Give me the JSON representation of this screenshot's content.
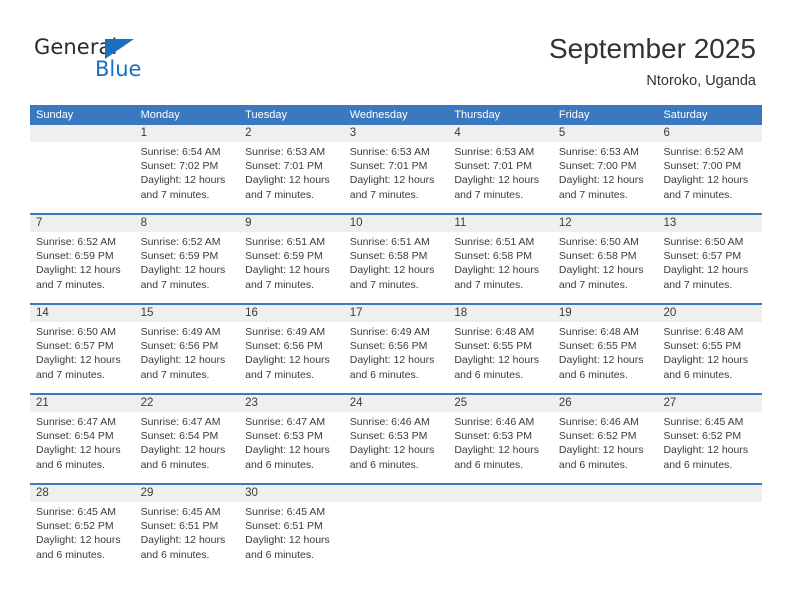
{
  "brand": {
    "name_top": "General",
    "name_bottom": "Blue",
    "triangle_color": "#1b6ec2",
    "text_color": "#2b2b2b"
  },
  "header": {
    "title": "September 2025",
    "subtitle": "Ntoroko, Uganda"
  },
  "theme": {
    "header_blue": "#3a79bf",
    "daynumber_band": "#efefef",
    "text": "#3b3b3b"
  },
  "weekday_headers": [
    "Sunday",
    "Monday",
    "Tuesday",
    "Wednesday",
    "Thursday",
    "Friday",
    "Saturday"
  ],
  "weeks": [
    {
      "days": [
        {
          "number": "",
          "lines": [
            "",
            "",
            "",
            ""
          ]
        },
        {
          "number": "1",
          "lines": [
            "Sunrise: 6:54 AM",
            "Sunset: 7:02 PM",
            "Daylight: 12 hours",
            "and 7 minutes."
          ]
        },
        {
          "number": "2",
          "lines": [
            "Sunrise: 6:53 AM",
            "Sunset: 7:01 PM",
            "Daylight: 12 hours",
            "and 7 minutes."
          ]
        },
        {
          "number": "3",
          "lines": [
            "Sunrise: 6:53 AM",
            "Sunset: 7:01 PM",
            "Daylight: 12 hours",
            "and 7 minutes."
          ]
        },
        {
          "number": "4",
          "lines": [
            "Sunrise: 6:53 AM",
            "Sunset: 7:01 PM",
            "Daylight: 12 hours",
            "and 7 minutes."
          ]
        },
        {
          "number": "5",
          "lines": [
            "Sunrise: 6:53 AM",
            "Sunset: 7:00 PM",
            "Daylight: 12 hours",
            "and 7 minutes."
          ]
        },
        {
          "number": "6",
          "lines": [
            "Sunrise: 6:52 AM",
            "Sunset: 7:00 PM",
            "Daylight: 12 hours",
            "and 7 minutes."
          ]
        }
      ]
    },
    {
      "days": [
        {
          "number": "7",
          "lines": [
            "Sunrise: 6:52 AM",
            "Sunset: 6:59 PM",
            "Daylight: 12 hours",
            "and 7 minutes."
          ]
        },
        {
          "number": "8",
          "lines": [
            "Sunrise: 6:52 AM",
            "Sunset: 6:59 PM",
            "Daylight: 12 hours",
            "and 7 minutes."
          ]
        },
        {
          "number": "9",
          "lines": [
            "Sunrise: 6:51 AM",
            "Sunset: 6:59 PM",
            "Daylight: 12 hours",
            "and 7 minutes."
          ]
        },
        {
          "number": "10",
          "lines": [
            "Sunrise: 6:51 AM",
            "Sunset: 6:58 PM",
            "Daylight: 12 hours",
            "and 7 minutes."
          ]
        },
        {
          "number": "11",
          "lines": [
            "Sunrise: 6:51 AM",
            "Sunset: 6:58 PM",
            "Daylight: 12 hours",
            "and 7 minutes."
          ]
        },
        {
          "number": "12",
          "lines": [
            "Sunrise: 6:50 AM",
            "Sunset: 6:58 PM",
            "Daylight: 12 hours",
            "and 7 minutes."
          ]
        },
        {
          "number": "13",
          "lines": [
            "Sunrise: 6:50 AM",
            "Sunset: 6:57 PM",
            "Daylight: 12 hours",
            "and 7 minutes."
          ]
        }
      ]
    },
    {
      "days": [
        {
          "number": "14",
          "lines": [
            "Sunrise: 6:50 AM",
            "Sunset: 6:57 PM",
            "Daylight: 12 hours",
            "and 7 minutes."
          ]
        },
        {
          "number": "15",
          "lines": [
            "Sunrise: 6:49 AM",
            "Sunset: 6:56 PM",
            "Daylight: 12 hours",
            "and 7 minutes."
          ]
        },
        {
          "number": "16",
          "lines": [
            "Sunrise: 6:49 AM",
            "Sunset: 6:56 PM",
            "Daylight: 12 hours",
            "and 7 minutes."
          ]
        },
        {
          "number": "17",
          "lines": [
            "Sunrise: 6:49 AM",
            "Sunset: 6:56 PM",
            "Daylight: 12 hours",
            "and 6 minutes."
          ]
        },
        {
          "number": "18",
          "lines": [
            "Sunrise: 6:48 AM",
            "Sunset: 6:55 PM",
            "Daylight: 12 hours",
            "and 6 minutes."
          ]
        },
        {
          "number": "19",
          "lines": [
            "Sunrise: 6:48 AM",
            "Sunset: 6:55 PM",
            "Daylight: 12 hours",
            "and 6 minutes."
          ]
        },
        {
          "number": "20",
          "lines": [
            "Sunrise: 6:48 AM",
            "Sunset: 6:55 PM",
            "Daylight: 12 hours",
            "and 6 minutes."
          ]
        }
      ]
    },
    {
      "days": [
        {
          "number": "21",
          "lines": [
            "Sunrise: 6:47 AM",
            "Sunset: 6:54 PM",
            "Daylight: 12 hours",
            "and 6 minutes."
          ]
        },
        {
          "number": "22",
          "lines": [
            "Sunrise: 6:47 AM",
            "Sunset: 6:54 PM",
            "Daylight: 12 hours",
            "and 6 minutes."
          ]
        },
        {
          "number": "23",
          "lines": [
            "Sunrise: 6:47 AM",
            "Sunset: 6:53 PM",
            "Daylight: 12 hours",
            "and 6 minutes."
          ]
        },
        {
          "number": "24",
          "lines": [
            "Sunrise: 6:46 AM",
            "Sunset: 6:53 PM",
            "Daylight: 12 hours",
            "and 6 minutes."
          ]
        },
        {
          "number": "25",
          "lines": [
            "Sunrise: 6:46 AM",
            "Sunset: 6:53 PM",
            "Daylight: 12 hours",
            "and 6 minutes."
          ]
        },
        {
          "number": "26",
          "lines": [
            "Sunrise: 6:46 AM",
            "Sunset: 6:52 PM",
            "Daylight: 12 hours",
            "and 6 minutes."
          ]
        },
        {
          "number": "27",
          "lines": [
            "Sunrise: 6:45 AM",
            "Sunset: 6:52 PM",
            "Daylight: 12 hours",
            "and 6 minutes."
          ]
        }
      ]
    },
    {
      "days": [
        {
          "number": "28",
          "lines": [
            "Sunrise: 6:45 AM",
            "Sunset: 6:52 PM",
            "Daylight: 12 hours",
            "and 6 minutes."
          ]
        },
        {
          "number": "29",
          "lines": [
            "Sunrise: 6:45 AM",
            "Sunset: 6:51 PM",
            "Daylight: 12 hours",
            "and 6 minutes."
          ]
        },
        {
          "number": "30",
          "lines": [
            "Sunrise: 6:45 AM",
            "Sunset: 6:51 PM",
            "Daylight: 12 hours",
            "and 6 minutes."
          ]
        },
        {
          "number": "",
          "lines": [
            "",
            "",
            "",
            ""
          ]
        },
        {
          "number": "",
          "lines": [
            "",
            "",
            "",
            ""
          ]
        },
        {
          "number": "",
          "lines": [
            "",
            "",
            "",
            ""
          ]
        },
        {
          "number": "",
          "lines": [
            "",
            "",
            "",
            ""
          ]
        }
      ]
    }
  ]
}
